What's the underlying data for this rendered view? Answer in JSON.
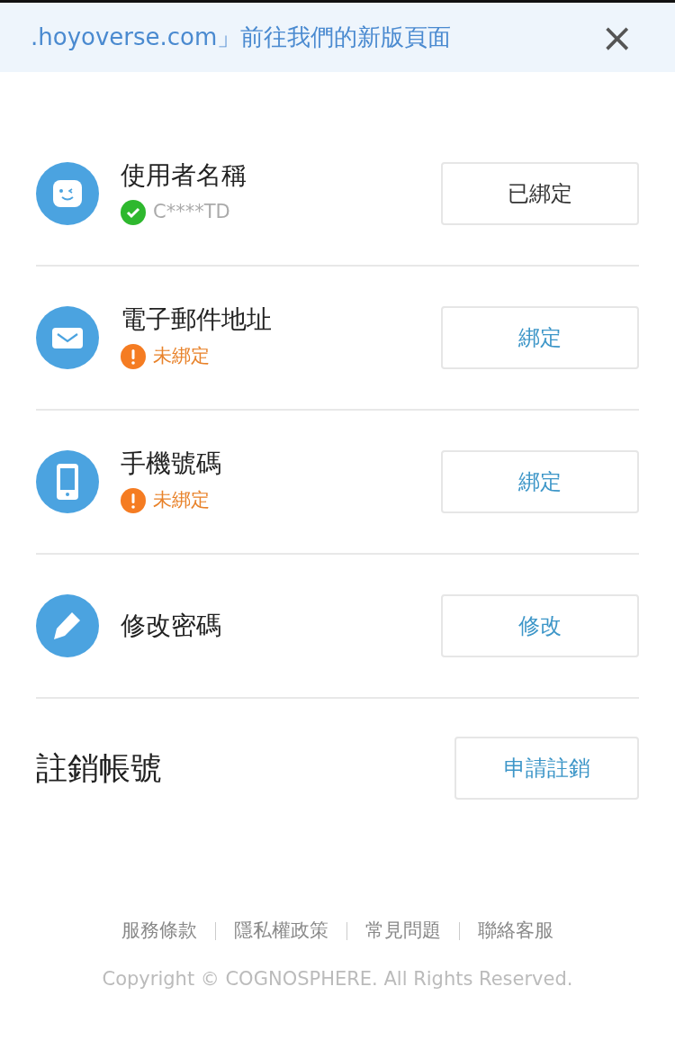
{
  "banner": {
    "text": ".hoyoverse.com」前往我們的新版頁面",
    "close": "×"
  },
  "items": [
    {
      "kind": "username",
      "title": "使用者名稱",
      "bound": true,
      "status": "C****TD",
      "button": "已綁定"
    },
    {
      "kind": "email",
      "title": "電子郵件地址",
      "bound": false,
      "status": "未綁定",
      "button": "綁定"
    },
    {
      "kind": "phone",
      "title": "手機號碼",
      "bound": false,
      "status": "未綁定",
      "button": "綁定"
    },
    {
      "kind": "password",
      "title": "修改密碼",
      "button": "修改"
    }
  ],
  "delete": {
    "title": "註銷帳號",
    "button": "申請註銷"
  },
  "footer": {
    "links": [
      "服務條款",
      "隱私權政策",
      "常見問題",
      "聯絡客服"
    ],
    "copyright": "Copyright © COGNOSPHERE. All Rights Reserved."
  }
}
